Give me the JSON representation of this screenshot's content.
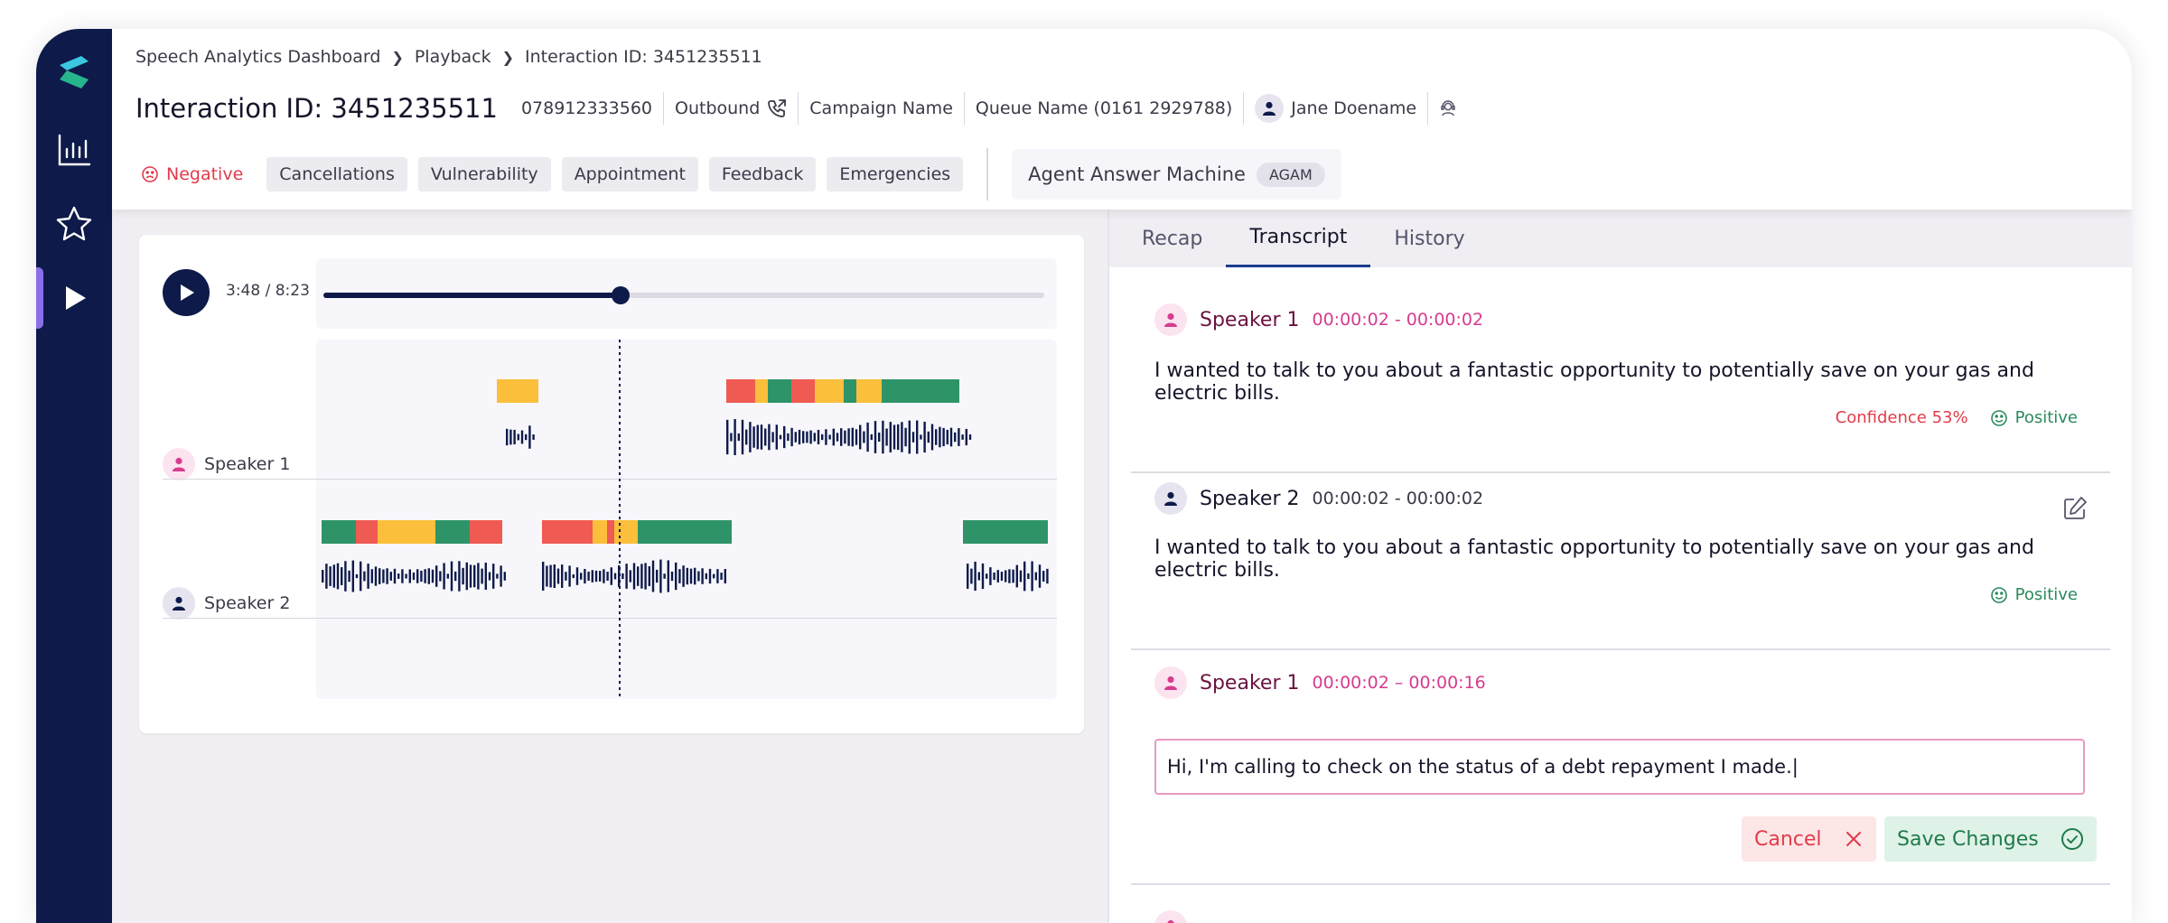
{
  "breadcrumb": [
    "Speech Analytics Dashboard",
    "Playback",
    "Interaction ID: 3451235511"
  ],
  "header": {
    "title": "Interaction ID: 3451235511",
    "phone": "078912333560",
    "direction": "Outbound",
    "campaign": "Campaign Name",
    "queue": "Queue Name (0161 2929788)",
    "agent": "Jane Doename"
  },
  "tags": {
    "sentiment": "Negative",
    "chips": [
      "Cancellations",
      "Vulnerability",
      "Appointment",
      "Feedback",
      "Emergencies"
    ]
  },
  "agent_mode": {
    "label": "Agent Answer Machine",
    "code": "AGAM"
  },
  "player": {
    "time": "3:48 / 8:23",
    "progress": 0.412
  },
  "tracks": {
    "speaker1": "Speaker 1",
    "speaker2": "Speaker 2"
  },
  "tabs": [
    "Recap",
    "Transcript",
    "History"
  ],
  "active_tab": "Transcript",
  "transcript": [
    {
      "speaker": "Speaker 1",
      "time": "00:00:02 - 00:00:02",
      "text": "I wanted to talk to you about a fantastic opportunity to potentially save on your gas and electric bills.",
      "confidence": "Confidence 53%",
      "sentiment": "Positive"
    },
    {
      "speaker": "Speaker 2",
      "time": "00:00:02 - 00:00:02",
      "text": "I wanted to talk to you about a fantastic opportunity to potentially save on your gas and electric bills.",
      "sentiment": "Positive"
    },
    {
      "speaker": "Speaker 1",
      "time": "00:00:02 – 00:00:16",
      "edit_value": "Hi, I'm calling to check on the status of a debt repayment I made.|",
      "cancel_label": "Cancel",
      "save_label": "Save Changes"
    }
  ],
  "colors": {
    "navy": "#0d1a4a",
    "pink": "#d63c8e",
    "green": "#2e9468",
    "red": "#ef5a52",
    "amber": "#fbbf3b",
    "accent": "#8b6fe8"
  }
}
